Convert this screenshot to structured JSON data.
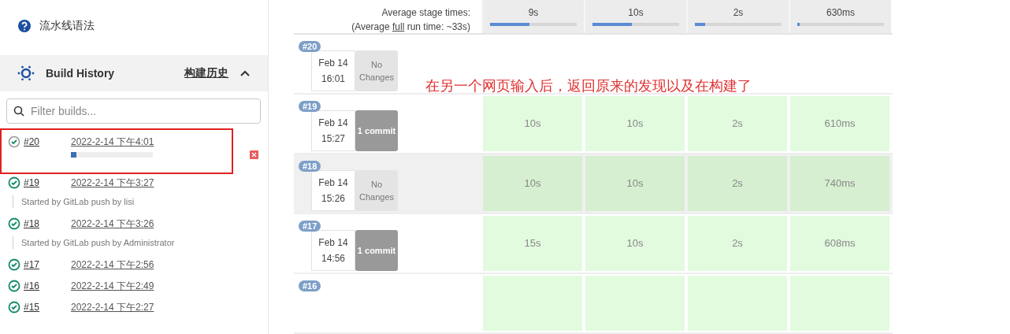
{
  "sidebar": {
    "syntax_link": "流水线语法",
    "build_history": {
      "title": "Build History",
      "link": "构建历史",
      "expanded": true,
      "filter": {
        "placeholder": "Filter builds..."
      },
      "builds": [
        {
          "number": "#20",
          "date": "2022-2-14 下午4:01",
          "kind": "running",
          "level": 0.07
        },
        {
          "number": "#19",
          "date": "2022-2-14 下午3:27",
          "kind": "success",
          "description": "Started by GitLab push by lisi"
        },
        {
          "number": "#18",
          "date": "2022-2-14 下午3:26",
          "kind": "success",
          "description": "Started by GitLab push by Administrator"
        },
        {
          "number": "#17",
          "date": "2022-2-14 下午2:56",
          "kind": "success"
        },
        {
          "number": "#16",
          "date": "2022-2-14 下午2:49",
          "kind": "success"
        },
        {
          "number": "#15",
          "date": "2022-2-14 下午2:27",
          "kind": "success"
        }
      ]
    }
  },
  "stage_view": {
    "average_label": "Average stage times:",
    "full_run": {
      "before": "(Average ",
      "link": "full",
      "after": " run time: ~33s)"
    },
    "stages": [
      {
        "time": "9s",
        "level": 0.45
      },
      {
        "time": "10s",
        "level": 0.45
      },
      {
        "time": "2s",
        "level": 0.12
      },
      {
        "time": "630ms",
        "level": 0.03
      }
    ],
    "runs": [
      {
        "number": "#20",
        "date": "Feb 14",
        "time": "16:01",
        "changes": "No Changes",
        "kind": "no-changes",
        "selected": false
      },
      {
        "number": "#19",
        "date": "Feb 14",
        "time": "15:27",
        "changes": "1 commit",
        "kind": "commit",
        "selected": false,
        "cells": [
          "10s",
          "10s",
          "2s",
          "610ms"
        ]
      },
      {
        "number": "#18",
        "date": "Feb 14",
        "time": "15:26",
        "changes": "No Changes",
        "kind": "no-changes",
        "selected": true,
        "cells": [
          "10s",
          "10s",
          "2s",
          "740ms"
        ]
      },
      {
        "number": "#17",
        "date": "Feb 14",
        "time": "14:56",
        "changes": "1 commit",
        "kind": "commit",
        "selected": false,
        "cells": [
          "15s",
          "10s",
          "2s",
          "608ms"
        ]
      },
      {
        "number": "#16",
        "kind": "partial",
        "selected": false
      }
    ]
  },
  "annotation": {
    "text": "在另一个网页输入后，返回原来的发现以及在构建了"
  }
}
